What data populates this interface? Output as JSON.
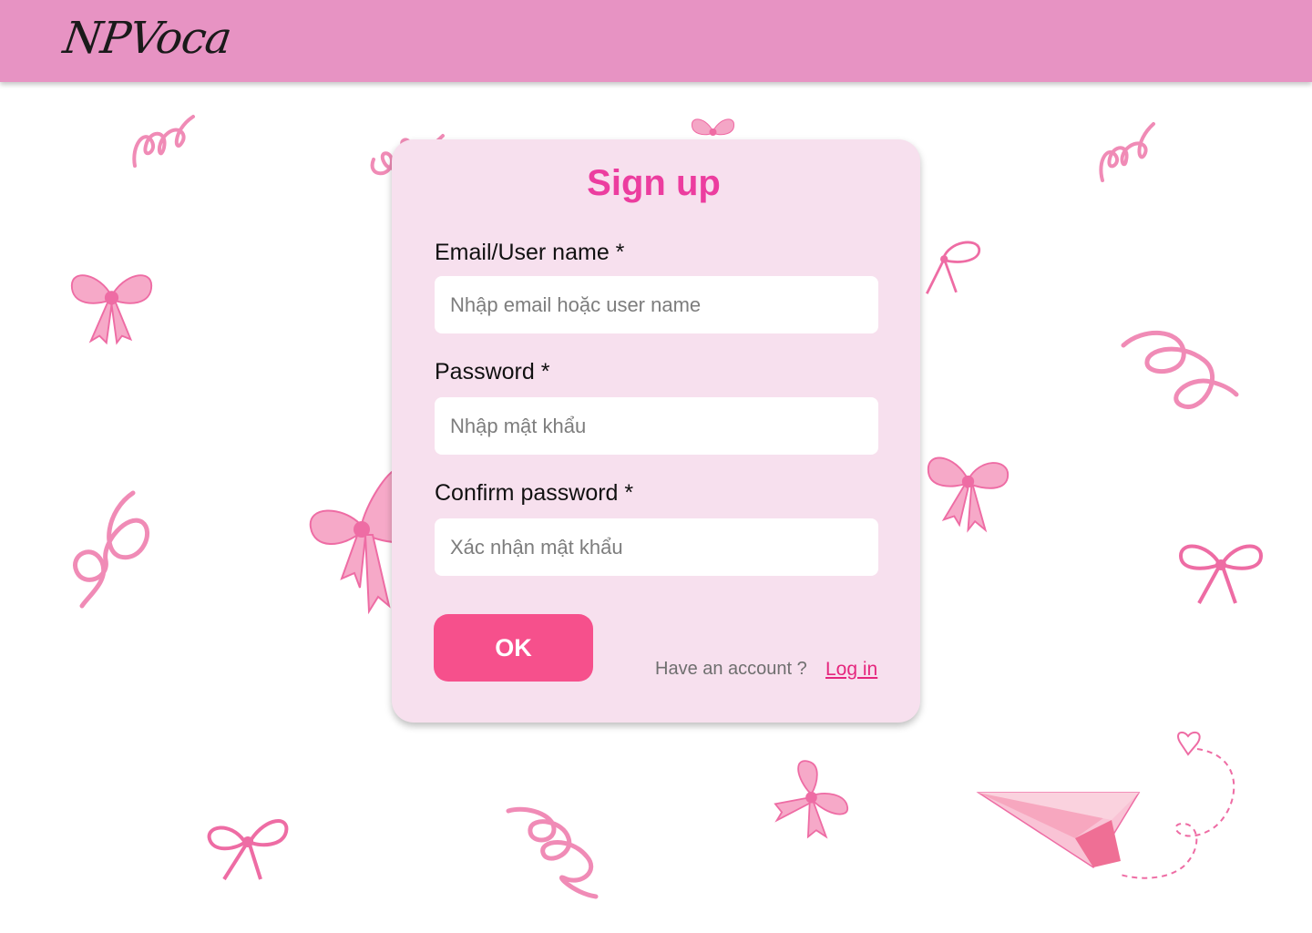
{
  "header": {
    "logo_text": "NPVoca",
    "bar_color": "#e793c3"
  },
  "signup": {
    "title": "Sign up",
    "email": {
      "label": "Email/User name *",
      "placeholder": "Nhập email hoặc user name",
      "value": ""
    },
    "password": {
      "label": "Password *",
      "placeholder": "Nhập mật khẩu",
      "value": ""
    },
    "confirm_password": {
      "label": "Confirm password *",
      "placeholder": "Xác nhận mật khẩu",
      "value": ""
    },
    "submit_label": "OK",
    "have_account_text": "Have an account ?",
    "login_link_text": "Log in"
  },
  "colors": {
    "card_background": "#f7e0ee",
    "title": "#ec3d9f",
    "button": "#f6508c",
    "link": "#e5267d",
    "ribbon": "#f48cb6"
  },
  "decorations": {
    "ribbon_bows": 10,
    "curly_ribbons": 7,
    "paper_plane": "paper-plane-icon"
  }
}
